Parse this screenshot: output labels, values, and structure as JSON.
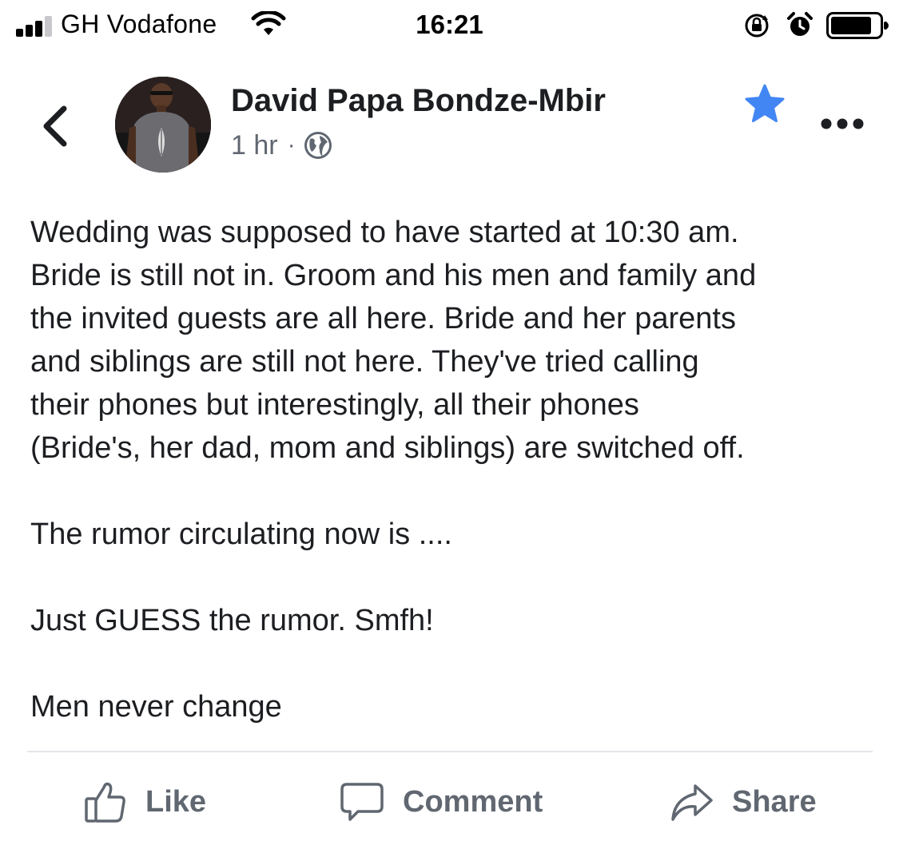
{
  "status_bar": {
    "carrier": "GH Vodafone",
    "time": "16:21",
    "signal_bars_filled": 3,
    "signal_bars_total": 4,
    "icons": [
      "wifi-icon",
      "rotation-lock-icon",
      "alarm-icon",
      "battery-icon"
    ]
  },
  "post": {
    "author": "David Papa Bondze-Mbir",
    "time_ago": "1 hr",
    "separator": "·",
    "privacy_icon": "globe-icon",
    "paragraphs": [
      "Wedding was supposed to have started at 10:30 am.\nBride is still not in. Groom and his men and family and\nthe invited guests are all here. Bride and her parents\nand siblings are still not here. They've tried calling\ntheir phones but interestingly, all their phones\n(Bride's, her dad, mom and siblings) are switched off.",
      "The rumor circulating now is ....",
      "Just GUESS the rumor. Smfh!",
      "Men never change"
    ]
  },
  "actions": {
    "like": "Like",
    "comment": "Comment",
    "share": "Share"
  },
  "colors": {
    "text": "#1c1e21",
    "secondary_text": "#606770",
    "star_blue": "#4286f4",
    "divider": "#e4e6eb"
  }
}
